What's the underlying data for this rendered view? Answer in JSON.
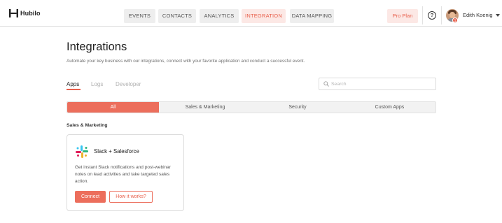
{
  "app": {
    "brand": "Hubilo"
  },
  "nav": {
    "tabs": [
      {
        "label": "EVENTS",
        "active": false
      },
      {
        "label": "CONTACTS",
        "active": false
      },
      {
        "label": "ANALYTICS",
        "active": false
      },
      {
        "label": "INTEGRATION",
        "active": true
      },
      {
        "label": "DATA MAPPING",
        "active": false
      }
    ]
  },
  "header_right": {
    "plan_label": "Pro Plan",
    "help_symbol": "?",
    "user_name": "Edith Koenig",
    "notification_count": "1"
  },
  "page": {
    "title": "Integrations",
    "subtitle": "Automate your key business with our integrations, connect with your favorite application and conduct a successful event."
  },
  "subtabs": [
    {
      "label": "Apps",
      "active": true
    },
    {
      "label": "Logs",
      "active": false
    },
    {
      "label": "Developer",
      "active": false
    }
  ],
  "search": {
    "placeholder": "Search",
    "value": ""
  },
  "filters": [
    {
      "label": "All",
      "active": true
    },
    {
      "label": "Sales & Marketing",
      "active": false
    },
    {
      "label": "Security",
      "active": false
    },
    {
      "label": "Custom Apps",
      "active": false
    }
  ],
  "section": {
    "label": "Sales & Marketing"
  },
  "cards": [
    {
      "title": "Slack + Salesforce",
      "description": "Get instant Slack notifications and post-webinar notes on lead activities and take targeted sales action.",
      "primary_button": "Connect",
      "secondary_button": "How it works?",
      "icon": "slack-logo-icon"
    }
  ],
  "colors": {
    "accent": "#ec6e5c",
    "accent_light": "#fce8e5",
    "nav_tab_bg": "#eeeeee",
    "filter_bg": "#f2f2f2"
  }
}
